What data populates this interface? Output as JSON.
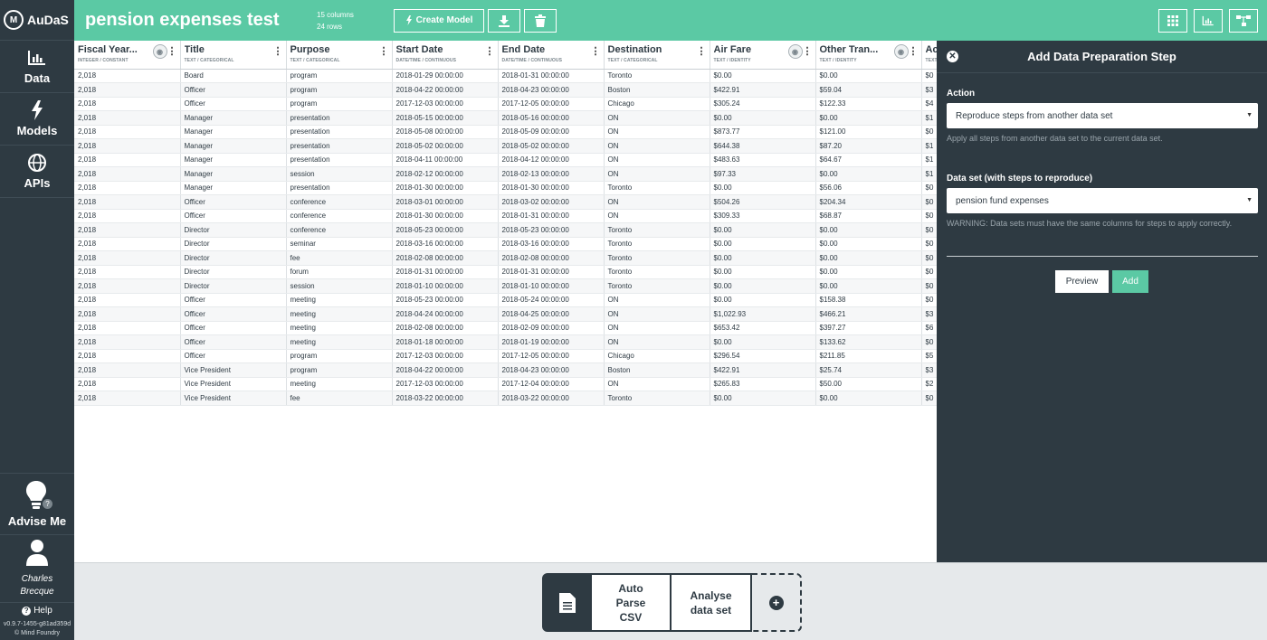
{
  "brand": {
    "name": "AuDaS"
  },
  "sidebar": {
    "items": [
      {
        "label": "Data",
        "icon": "bar-chart-icon"
      },
      {
        "label": "Models",
        "icon": "lightning-icon"
      },
      {
        "label": "APIs",
        "icon": "globe-icon"
      }
    ],
    "advise_label": "Advise Me",
    "advise_badge": "?",
    "user_first": "Charles",
    "user_last": "Brecque",
    "help_label": "Help",
    "version": "v0.9.7-1455-g81ad359d",
    "copyright": "© Mind Foundry"
  },
  "topbar": {
    "title": "pension expenses test",
    "columns": "15 columns",
    "rows": "24 rows",
    "create_model": "Create Model"
  },
  "table": {
    "columns": [
      {
        "name": "Fiscal Year...",
        "type": "INTEGER / CONSTANT"
      },
      {
        "name": "Title",
        "type": "TEXT / CATEGORICAL"
      },
      {
        "name": "Purpose",
        "type": "TEXT / CATEGORICAL"
      },
      {
        "name": "Start Date",
        "type": "DATE/TIME / CONTINUOUS"
      },
      {
        "name": "End Date",
        "type": "DATE/TIME / CONTINUOUS"
      },
      {
        "name": "Destination",
        "type": "TEXT / CATEGORICAL"
      },
      {
        "name": "Air Fare",
        "type": "TEXT / IDENTITY"
      },
      {
        "name": "Other Tran...",
        "type": "TEXT / IDENTITY"
      },
      {
        "name": "Ac",
        "type": "TEXT"
      }
    ],
    "rows": [
      [
        "2,018",
        "Board",
        "program",
        "2018-01-29 00:00:00",
        "2018-01-31 00:00:00",
        "Toronto",
        "$0.00",
        "$0.00",
        "$0"
      ],
      [
        "2,018",
        "Officer",
        "program",
        "2018-04-22 00:00:00",
        "2018-04-23 00:00:00",
        "Boston",
        "$422.91",
        "$59.04",
        "$3"
      ],
      [
        "2,018",
        "Officer",
        "program",
        "2017-12-03 00:00:00",
        "2017-12-05 00:00:00",
        "Chicago",
        "$305.24",
        "$122.33",
        "$4"
      ],
      [
        "2,018",
        "Manager",
        "presentation",
        "2018-05-15 00:00:00",
        "2018-05-16 00:00:00",
        "ON",
        "$0.00",
        "$0.00",
        "$1"
      ],
      [
        "2,018",
        "Manager",
        "presentation",
        "2018-05-08 00:00:00",
        "2018-05-09 00:00:00",
        "ON",
        "$873.77",
        "$121.00",
        "$0"
      ],
      [
        "2,018",
        "Manager",
        "presentation",
        "2018-05-02 00:00:00",
        "2018-05-02 00:00:00",
        "ON",
        "$644.38",
        "$87.20",
        "$1"
      ],
      [
        "2,018",
        "Manager",
        "presentation",
        "2018-04-11 00:00:00",
        "2018-04-12 00:00:00",
        "ON",
        "$483.63",
        "$64.67",
        "$1"
      ],
      [
        "2,018",
        "Manager",
        "session",
        "2018-02-12 00:00:00",
        "2018-02-13 00:00:00",
        "ON",
        "$97.33",
        "$0.00",
        "$1"
      ],
      [
        "2,018",
        "Manager",
        "presentation",
        "2018-01-30 00:00:00",
        "2018-01-30 00:00:00",
        "Toronto",
        "$0.00",
        "$56.06",
        "$0"
      ],
      [
        "2,018",
        "Officer",
        "conference",
        "2018-03-01 00:00:00",
        "2018-03-02 00:00:00",
        "ON",
        "$504.26",
        "$204.34",
        "$0"
      ],
      [
        "2,018",
        "Officer",
        "conference",
        "2018-01-30 00:00:00",
        "2018-01-31 00:00:00",
        "ON",
        "$309.33",
        "$68.87",
        "$0"
      ],
      [
        "2,018",
        "Director",
        "conference",
        "2018-05-23 00:00:00",
        "2018-05-23 00:00:00",
        "Toronto",
        "$0.00",
        "$0.00",
        "$0"
      ],
      [
        "2,018",
        "Director",
        "seminar",
        "2018-03-16 00:00:00",
        "2018-03-16 00:00:00",
        "Toronto",
        "$0.00",
        "$0.00",
        "$0"
      ],
      [
        "2,018",
        "Director",
        "fee",
        "2018-02-08 00:00:00",
        "2018-02-08 00:00:00",
        "Toronto",
        "$0.00",
        "$0.00",
        "$0"
      ],
      [
        "2,018",
        "Director",
        "forum",
        "2018-01-31 00:00:00",
        "2018-01-31 00:00:00",
        "Toronto",
        "$0.00",
        "$0.00",
        "$0"
      ],
      [
        "2,018",
        "Director",
        "session",
        "2018-01-10 00:00:00",
        "2018-01-10 00:00:00",
        "Toronto",
        "$0.00",
        "$0.00",
        "$0"
      ],
      [
        "2,018",
        "Officer",
        "meeting",
        "2018-05-23 00:00:00",
        "2018-05-24 00:00:00",
        "ON",
        "$0.00",
        "$158.38",
        "$0"
      ],
      [
        "2,018",
        "Officer",
        "meeting",
        "2018-04-24 00:00:00",
        "2018-04-25 00:00:00",
        "ON",
        "$1,022.93",
        "$466.21",
        "$3"
      ],
      [
        "2,018",
        "Officer",
        "meeting",
        "2018-02-08 00:00:00",
        "2018-02-09 00:00:00",
        "ON",
        "$653.42",
        "$397.27",
        "$6"
      ],
      [
        "2,018",
        "Officer",
        "meeting",
        "2018-01-18 00:00:00",
        "2018-01-19 00:00:00",
        "ON",
        "$0.00",
        "$133.62",
        "$0"
      ],
      [
        "2,018",
        "Officer",
        "program",
        "2017-12-03 00:00:00",
        "2017-12-05 00:00:00",
        "Chicago",
        "$296.54",
        "$211.85",
        "$5"
      ],
      [
        "2,018",
        "Vice President",
        "program",
        "2018-04-22 00:00:00",
        "2018-04-23 00:00:00",
        "Boston",
        "$422.91",
        "$25.74",
        "$3"
      ],
      [
        "2,018",
        "Vice President",
        "meeting",
        "2017-12-03 00:00:00",
        "2017-12-04 00:00:00",
        "ON",
        "$265.83",
        "$50.00",
        "$2"
      ],
      [
        "2,018",
        "Vice President",
        "fee",
        "2018-03-22 00:00:00",
        "2018-03-22 00:00:00",
        "Toronto",
        "$0.00",
        "$0.00",
        "$0"
      ]
    ]
  },
  "panel": {
    "title": "Add Data Preparation Step",
    "action_label": "Action",
    "action_value": "Reproduce steps from another data set",
    "action_hint": "Apply all steps from another data set to the current data set.",
    "dataset_label": "Data set (with steps to reproduce)",
    "dataset_value": "pension fund expenses",
    "dataset_hint": "WARNING: Data sets must have the same columns for steps to apply correctly.",
    "preview": "Preview",
    "add": "Add"
  },
  "pipeline": {
    "steps": [
      "Auto\nParse\nCSV",
      "Analyse\ndata set"
    ],
    "step1_lines": [
      "Auto",
      "Parse",
      "CSV"
    ],
    "step2_lines": [
      "Analyse",
      "data set"
    ]
  },
  "colors": {
    "accent": "#5bc9a4",
    "dark": "#2e3a42"
  }
}
